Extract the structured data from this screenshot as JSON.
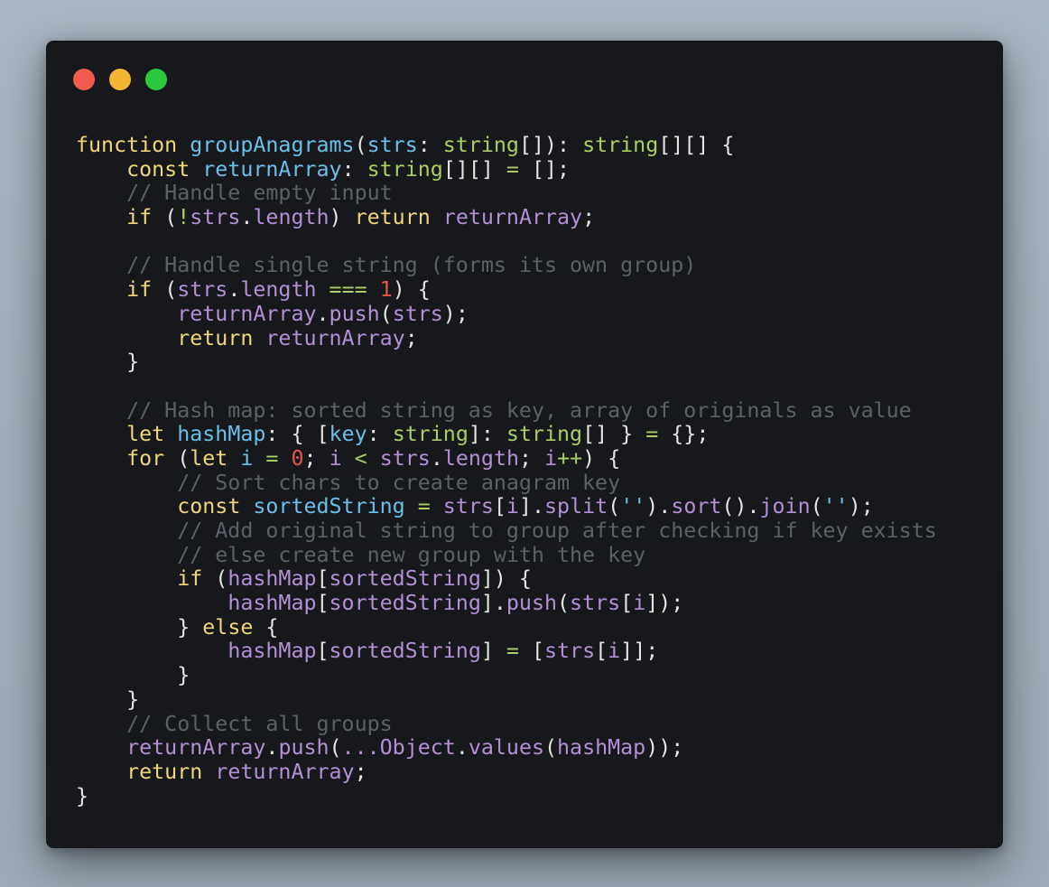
{
  "window": {
    "dots": [
      {
        "name": "close",
        "color": "#f25a51"
      },
      {
        "name": "minimize",
        "color": "#f4b532"
      },
      {
        "name": "zoom",
        "color": "#29c840"
      }
    ]
  },
  "theme": {
    "plain": "#e4e4e0",
    "keyword": "#efd67a",
    "func": "#6ac0e8",
    "type": "#a9cf63",
    "var": "#b48fd6",
    "comment": "#5a6168",
    "number": "#e8534a",
    "string": "#6ac0e8",
    "op": "#a9cf63"
  },
  "code": [
    [
      [
        "function ",
        "keyword"
      ],
      [
        "groupAnagrams",
        "func"
      ],
      [
        "(",
        "plain"
      ],
      [
        "strs",
        "func"
      ],
      [
        ": ",
        "plain"
      ],
      [
        "string",
        "type"
      ],
      [
        "[]): ",
        "plain"
      ],
      [
        "string",
        "type"
      ],
      [
        "[][] {",
        "plain"
      ]
    ],
    [
      [
        "    ",
        "plain"
      ],
      [
        "const ",
        "keyword"
      ],
      [
        "returnArray",
        "func"
      ],
      [
        ": ",
        "plain"
      ],
      [
        "string",
        "type"
      ],
      [
        "[][] ",
        "plain"
      ],
      [
        "=",
        "op"
      ],
      [
        " [];",
        "plain"
      ]
    ],
    [
      [
        "    // Handle empty input",
        "comment"
      ]
    ],
    [
      [
        "    ",
        "plain"
      ],
      [
        "if ",
        "keyword"
      ],
      [
        "(",
        "plain"
      ],
      [
        "!",
        "op"
      ],
      [
        "strs",
        "var"
      ],
      [
        ".",
        "plain"
      ],
      [
        "length",
        "var"
      ],
      [
        ") ",
        "plain"
      ],
      [
        "return ",
        "keyword"
      ],
      [
        "returnArray",
        "var"
      ],
      [
        ";",
        "plain"
      ]
    ],
    [],
    [
      [
        "    // Handle single string (forms its own group)",
        "comment"
      ]
    ],
    [
      [
        "    ",
        "plain"
      ],
      [
        "if ",
        "keyword"
      ],
      [
        "(",
        "plain"
      ],
      [
        "strs",
        "var"
      ],
      [
        ".",
        "plain"
      ],
      [
        "length",
        "var"
      ],
      [
        " ",
        "plain"
      ],
      [
        "===",
        "op"
      ],
      [
        " ",
        "plain"
      ],
      [
        "1",
        "number"
      ],
      [
        ") {",
        "plain"
      ]
    ],
    [
      [
        "        ",
        "plain"
      ],
      [
        "returnArray",
        "var"
      ],
      [
        ".",
        "plain"
      ],
      [
        "push",
        "var"
      ],
      [
        "(",
        "plain"
      ],
      [
        "strs",
        "var"
      ],
      [
        ");",
        "plain"
      ]
    ],
    [
      [
        "        ",
        "plain"
      ],
      [
        "return ",
        "keyword"
      ],
      [
        "returnArray",
        "var"
      ],
      [
        ";",
        "plain"
      ]
    ],
    [
      [
        "    }",
        "plain"
      ]
    ],
    [],
    [
      [
        "    // Hash map: sorted string as key, array of originals as value",
        "comment"
      ]
    ],
    [
      [
        "    ",
        "plain"
      ],
      [
        "let ",
        "keyword"
      ],
      [
        "hashMap",
        "func"
      ],
      [
        ": { [",
        "plain"
      ],
      [
        "key",
        "func"
      ],
      [
        ": ",
        "plain"
      ],
      [
        "string",
        "type"
      ],
      [
        "]: ",
        "plain"
      ],
      [
        "string",
        "type"
      ],
      [
        "[] } ",
        "plain"
      ],
      [
        "=",
        "op"
      ],
      [
        " {};",
        "plain"
      ]
    ],
    [
      [
        "    ",
        "plain"
      ],
      [
        "for ",
        "keyword"
      ],
      [
        "(",
        "plain"
      ],
      [
        "let ",
        "keyword"
      ],
      [
        "i",
        "func"
      ],
      [
        " ",
        "plain"
      ],
      [
        "=",
        "op"
      ],
      [
        " ",
        "plain"
      ],
      [
        "0",
        "number"
      ],
      [
        "; ",
        "plain"
      ],
      [
        "i",
        "var"
      ],
      [
        " ",
        "plain"
      ],
      [
        "<",
        "op"
      ],
      [
        " ",
        "plain"
      ],
      [
        "strs",
        "var"
      ],
      [
        ".",
        "plain"
      ],
      [
        "length",
        "var"
      ],
      [
        "; ",
        "plain"
      ],
      [
        "i",
        "var"
      ],
      [
        "++",
        "op"
      ],
      [
        ") {",
        "plain"
      ]
    ],
    [
      [
        "        // Sort chars to create anagram key",
        "comment"
      ]
    ],
    [
      [
        "        ",
        "plain"
      ],
      [
        "const ",
        "keyword"
      ],
      [
        "sortedString",
        "func"
      ],
      [
        " ",
        "plain"
      ],
      [
        "=",
        "op"
      ],
      [
        " ",
        "plain"
      ],
      [
        "strs",
        "var"
      ],
      [
        "[",
        "plain"
      ],
      [
        "i",
        "var"
      ],
      [
        "].",
        "plain"
      ],
      [
        "split",
        "var"
      ],
      [
        "(",
        "plain"
      ],
      [
        "''",
        "string"
      ],
      [
        ").",
        "plain"
      ],
      [
        "sort",
        "var"
      ],
      [
        "().",
        "plain"
      ],
      [
        "join",
        "var"
      ],
      [
        "(",
        "plain"
      ],
      [
        "''",
        "string"
      ],
      [
        ");",
        "plain"
      ]
    ],
    [
      [
        "        // Add original string to group after checking if key exists",
        "comment"
      ]
    ],
    [
      [
        "        // else create new group with the key",
        "comment"
      ]
    ],
    [
      [
        "        ",
        "plain"
      ],
      [
        "if ",
        "keyword"
      ],
      [
        "(",
        "plain"
      ],
      [
        "hashMap",
        "var"
      ],
      [
        "[",
        "plain"
      ],
      [
        "sortedString",
        "var"
      ],
      [
        "]) {",
        "plain"
      ]
    ],
    [
      [
        "            ",
        "plain"
      ],
      [
        "hashMap",
        "var"
      ],
      [
        "[",
        "plain"
      ],
      [
        "sortedString",
        "var"
      ],
      [
        "].",
        "plain"
      ],
      [
        "push",
        "var"
      ],
      [
        "(",
        "plain"
      ],
      [
        "strs",
        "var"
      ],
      [
        "[",
        "plain"
      ],
      [
        "i",
        "var"
      ],
      [
        "]);",
        "plain"
      ]
    ],
    [
      [
        "        } ",
        "plain"
      ],
      [
        "else ",
        "keyword"
      ],
      [
        "{",
        "plain"
      ]
    ],
    [
      [
        "            ",
        "plain"
      ],
      [
        "hashMap",
        "var"
      ],
      [
        "[",
        "plain"
      ],
      [
        "sortedString",
        "var"
      ],
      [
        "] ",
        "plain"
      ],
      [
        "=",
        "op"
      ],
      [
        " [",
        "plain"
      ],
      [
        "strs",
        "var"
      ],
      [
        "[",
        "plain"
      ],
      [
        "i",
        "var"
      ],
      [
        "]];",
        "plain"
      ]
    ],
    [
      [
        "        }",
        "plain"
      ]
    ],
    [
      [
        "    }",
        "plain"
      ]
    ],
    [
      [
        "    // Collect all groups",
        "comment"
      ]
    ],
    [
      [
        "    ",
        "plain"
      ],
      [
        "returnArray",
        "var"
      ],
      [
        ".",
        "plain"
      ],
      [
        "push",
        "var"
      ],
      [
        "(",
        "plain"
      ],
      [
        "...",
        "var"
      ],
      [
        "Object",
        "var"
      ],
      [
        ".",
        "plain"
      ],
      [
        "values",
        "var"
      ],
      [
        "(",
        "plain"
      ],
      [
        "hashMap",
        "var"
      ],
      [
        "));",
        "plain"
      ]
    ],
    [
      [
        "    ",
        "plain"
      ],
      [
        "return ",
        "keyword"
      ],
      [
        "returnArray",
        "var"
      ],
      [
        ";",
        "plain"
      ]
    ],
    [
      [
        "}",
        "plain"
      ]
    ]
  ]
}
